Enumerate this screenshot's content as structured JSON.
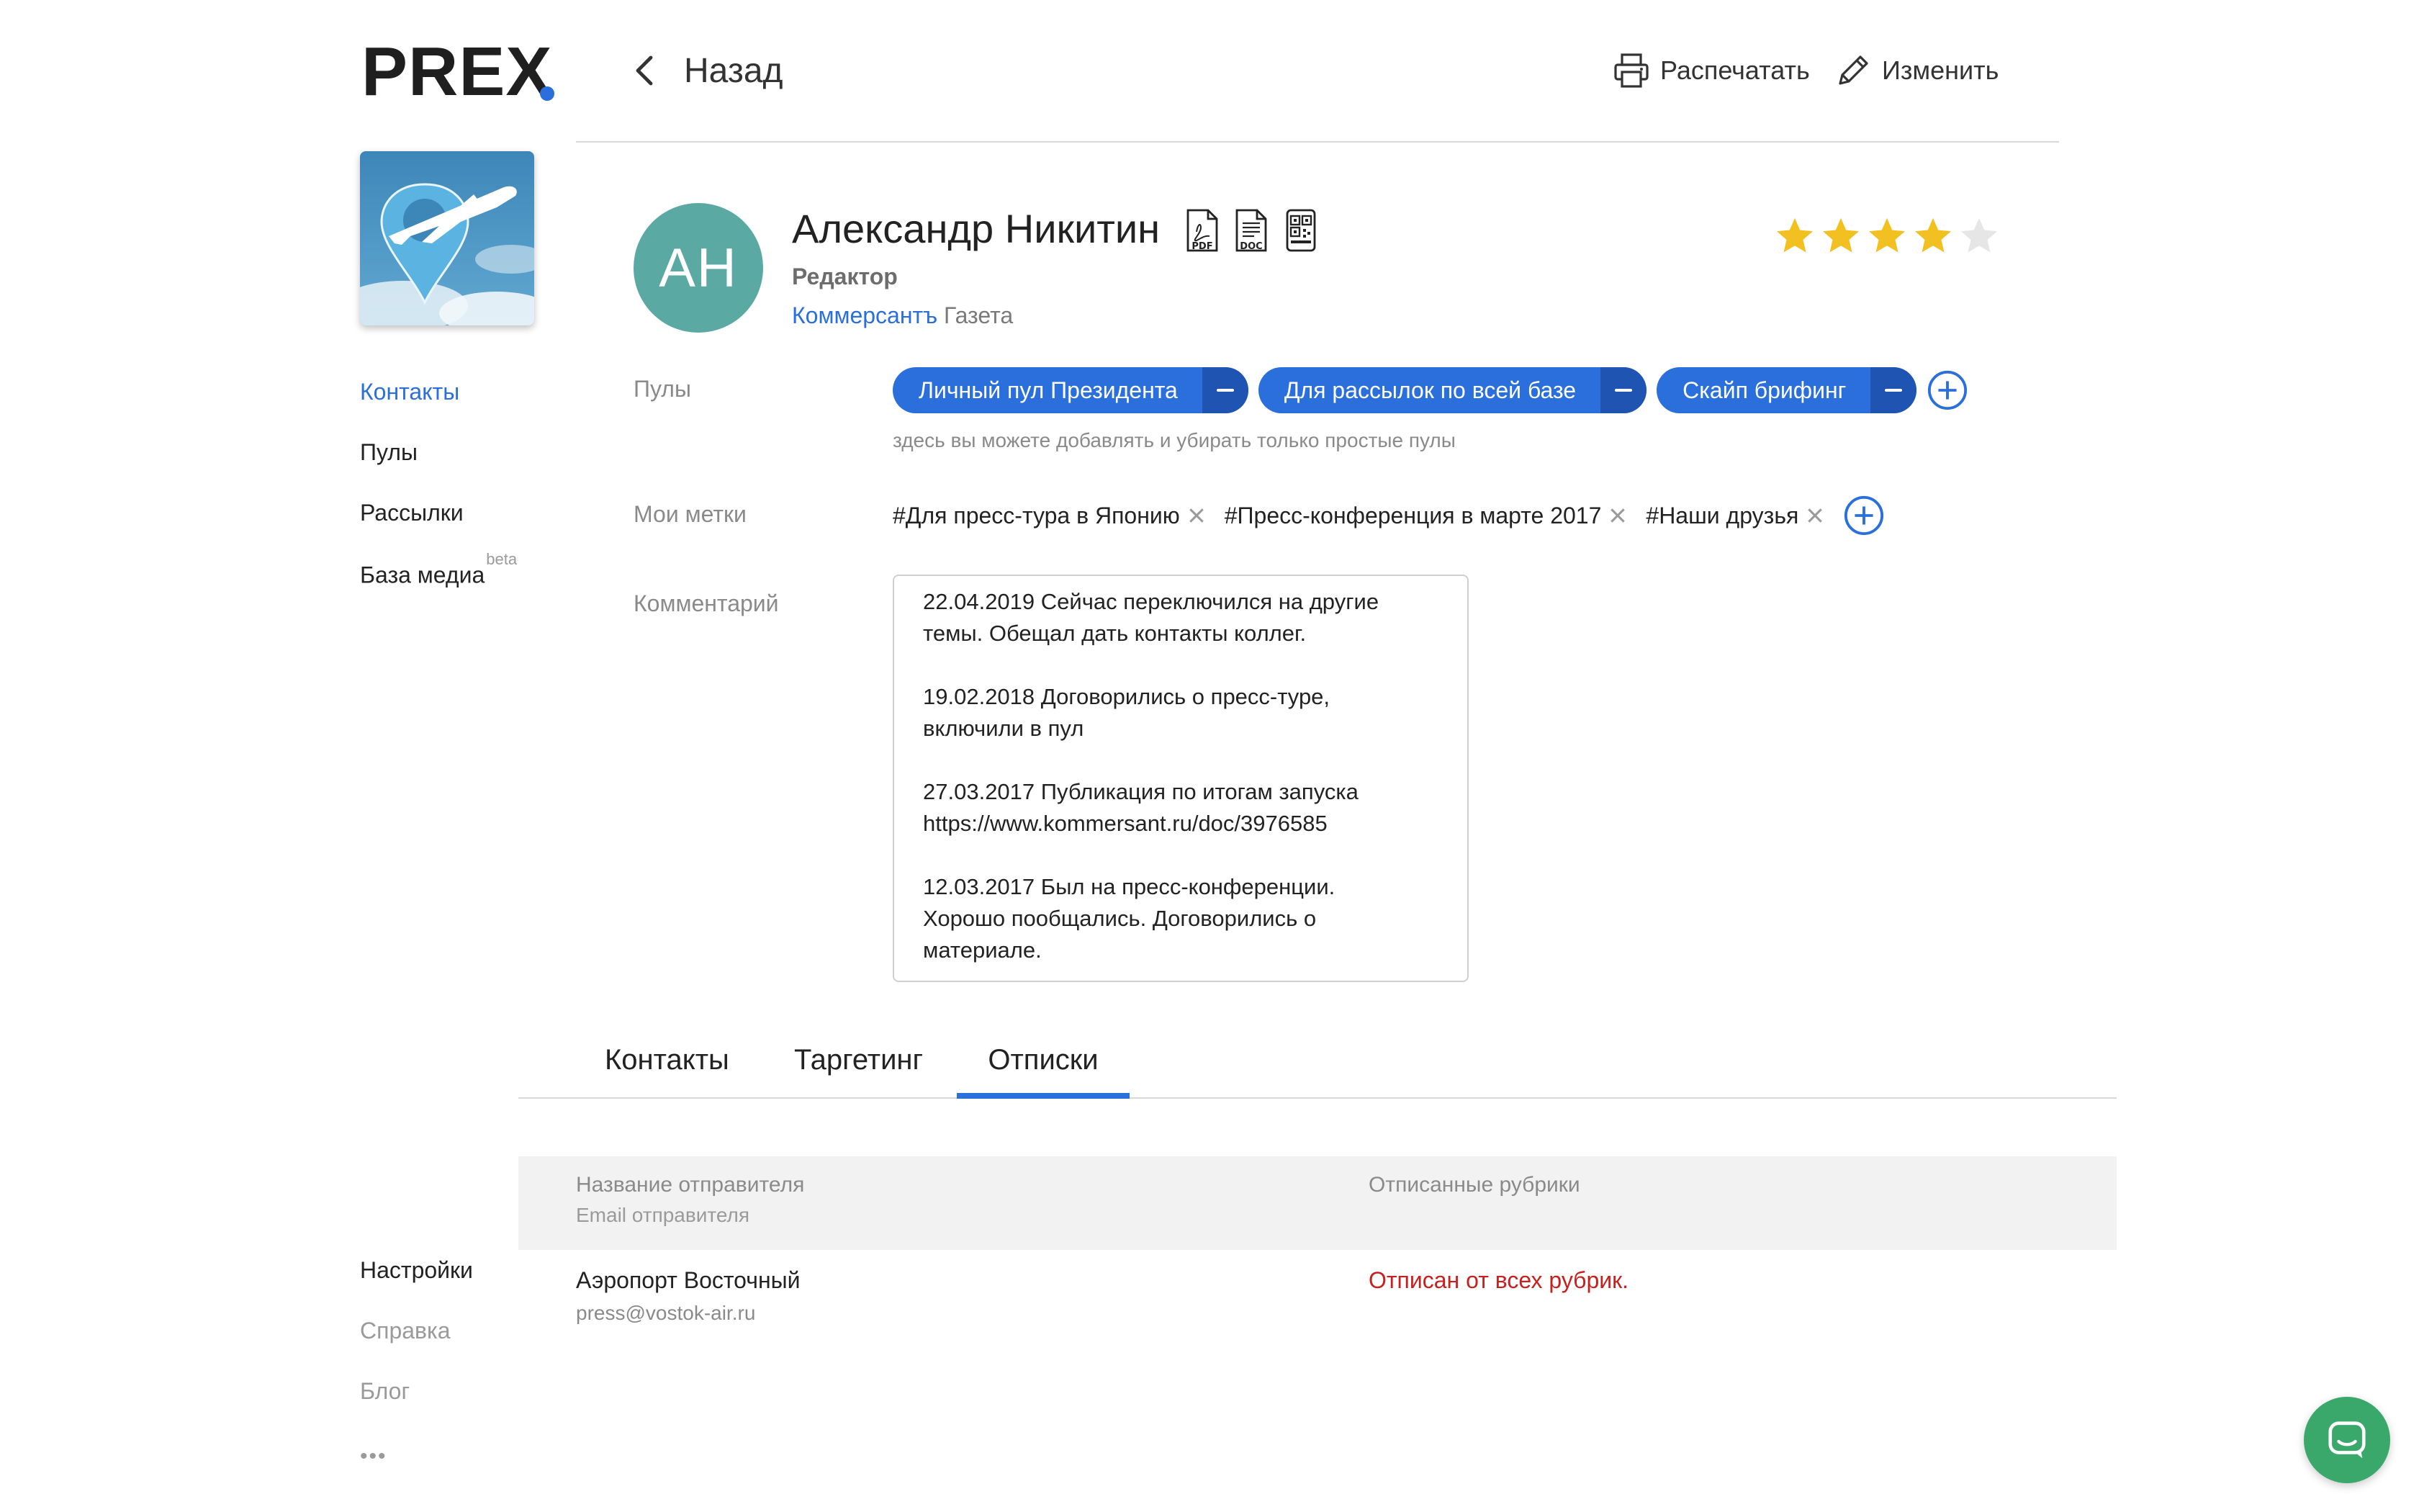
{
  "app": {
    "logo_text": "PREX",
    "brand_color": "#2a6fdb"
  },
  "header": {
    "back_label": "Назад",
    "print_label": "Распечатать",
    "edit_label": "Изменить"
  },
  "sidebar": {
    "items": [
      {
        "label": "Контакты",
        "active": true
      },
      {
        "label": "Пулы"
      },
      {
        "label": "Рассылки"
      },
      {
        "label": "База медиа",
        "badge": "beta"
      }
    ],
    "bottom_items": [
      {
        "label": "Настройки"
      },
      {
        "label": "Справка"
      },
      {
        "label": "Блог"
      }
    ],
    "more_label": "•••"
  },
  "profile": {
    "initials": "АН",
    "name": "Александр Никитин",
    "role": "Редактор",
    "organization": "Коммерсантъ",
    "organization_type": "Газета",
    "export_icons": [
      "pdf-icon",
      "doc-icon",
      "qr-code-icon"
    ],
    "export_labels": [
      "PDF",
      "DOC"
    ],
    "rating": 4,
    "rating_max": 5,
    "avatar_color": "#5aa9a3",
    "star_color": "#f3c022"
  },
  "pools": {
    "label": "Пулы",
    "items": [
      "Личный пул Президента",
      "Для рассылок по всей базе",
      "Скайп брифинг"
    ],
    "hint": "здесь вы можете добавлять и убирать только простые пулы"
  },
  "tags": {
    "label": "Мои метки",
    "items": [
      "#Для пресс-тура в Японию",
      "#Пресс-конференция в марте 2017",
      "#Наши друзья"
    ]
  },
  "comment": {
    "label": "Комментарий",
    "entries": [
      "22.04.2019 Сейчас переключился на другие\nтемы. Обещал дать контакты коллег.",
      "19.02.2018 Договорились о пресс-туре,\nвключили в пул",
      "27.03.2017 Публикация по итогам запуска\nhttps://www.kommersant.ru/doc/3976585",
      "12.03.2017 Был на пресс-конференции.\nХорошо пообщались. Договорились о\nматериале."
    ]
  },
  "tabs": {
    "items": [
      "Контакты",
      "Таргетинг",
      "Отписки"
    ],
    "active_index": 2
  },
  "unsubscribes": {
    "columns": {
      "sender_name": "Название отправителя",
      "sender_email": "Email отправителя",
      "rubrics": "Отписанные рубрики"
    },
    "rows": [
      {
        "sender": "Аэропорт Восточный",
        "email": "press@vostok-air.ru",
        "status": "Отписан от всех рубрик."
      }
    ],
    "status_color": "#c8201e"
  },
  "chat": {
    "icon": "chat-icon",
    "color": "#3aa86a"
  }
}
